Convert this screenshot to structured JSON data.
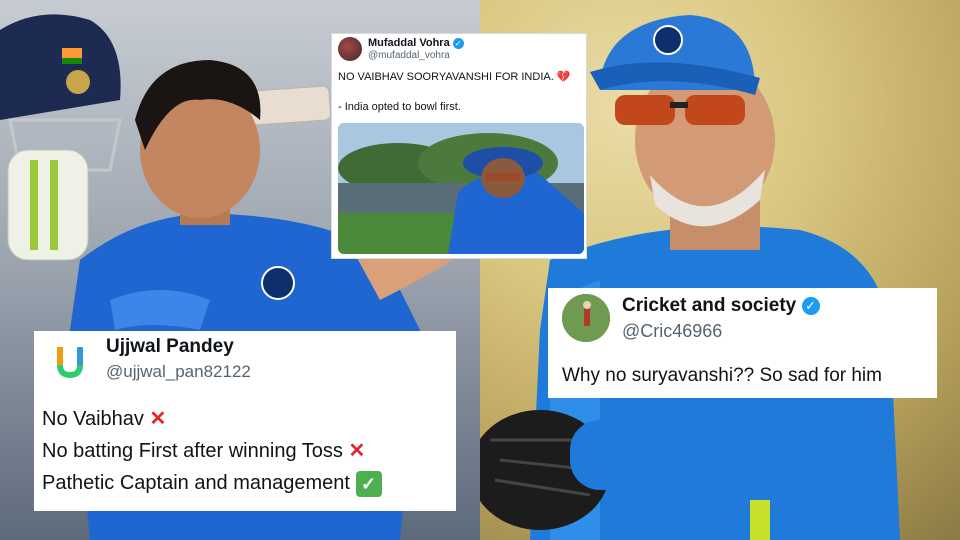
{
  "tweet_top": {
    "name": "Mufaddal Vohra",
    "handle": "@mufaddal_vohra",
    "line1": "NO VAIBHAV SOORYAVANSHI FOR INDIA. 💔",
    "line2": "- India opted to bowl first."
  },
  "tweet_left": {
    "name": "Ujjwal Pandey",
    "handle": "@ujjwal_pan82122",
    "lines": [
      "No Vaibhav",
      "No batting First after winning Toss",
      "Pathetic Captain and management"
    ]
  },
  "tweet_right": {
    "name": "Cricket and society",
    "handle": "@Cric46966",
    "text": "Why no suryavanshi?? So sad for him"
  },
  "colors": {
    "verified_blue": "#1d9bf0",
    "cross_red": "#e3242b",
    "check_green": "#4caf50",
    "india_blue": "#1f66d1"
  }
}
